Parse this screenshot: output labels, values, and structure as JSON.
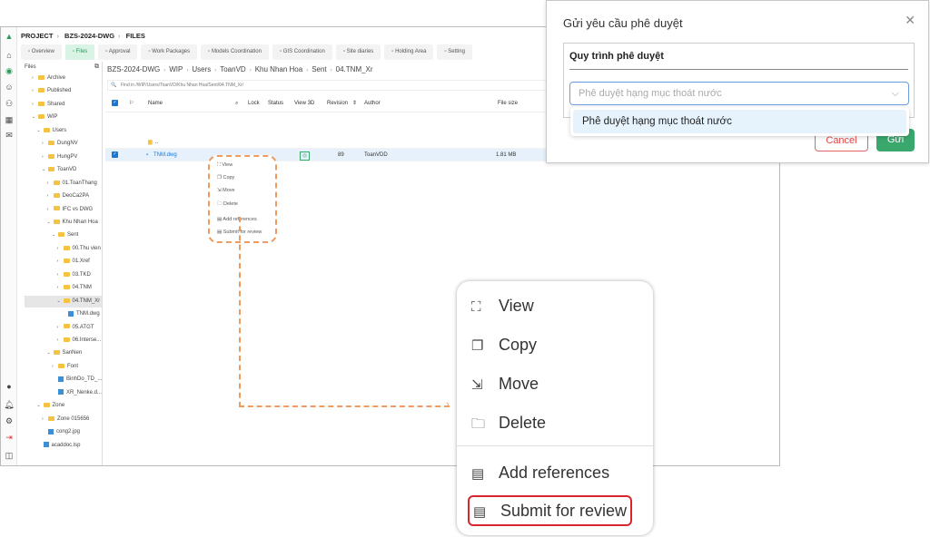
{
  "breadcrumb": [
    "PROJECT",
    "BZS-2024-DWG",
    "FILES"
  ],
  "tabs": [
    {
      "label": "Overview",
      "icon": "chart-icon"
    },
    {
      "label": "Files",
      "icon": "folder-icon",
      "active": true
    },
    {
      "label": "Approval",
      "icon": "doc-icon"
    },
    {
      "label": "Work Packages",
      "icon": "package-icon"
    },
    {
      "label": "Models Coordination",
      "icon": "model-icon"
    },
    {
      "label": "GIS Coordination",
      "icon": "globe-icon"
    },
    {
      "label": "Site diaries",
      "icon": "diary-icon"
    },
    {
      "label": "Holding Area",
      "icon": "warning-icon"
    },
    {
      "label": "Setting",
      "icon": "gear-icon"
    }
  ],
  "tree": {
    "header": "Files",
    "items": [
      {
        "label": "Archive",
        "depth": 0,
        "type": "folder",
        "caret": "›"
      },
      {
        "label": "Published",
        "depth": 0,
        "type": "folder",
        "caret": "›"
      },
      {
        "label": "Shared",
        "depth": 0,
        "type": "folder",
        "caret": "›"
      },
      {
        "label": "WIP",
        "depth": 0,
        "type": "folder",
        "caret": "⌄"
      },
      {
        "label": "Users",
        "depth": 1,
        "type": "folder",
        "caret": "⌄"
      },
      {
        "label": "DungNV",
        "depth": 2,
        "type": "folder",
        "caret": "›"
      },
      {
        "label": "HungPV",
        "depth": 2,
        "type": "folder",
        "caret": "›"
      },
      {
        "label": "ToanVD",
        "depth": 2,
        "type": "folder",
        "caret": "⌄"
      },
      {
        "label": "01.ToanThang",
        "depth": 3,
        "type": "folder",
        "caret": "›"
      },
      {
        "label": "DeoCa2PA",
        "depth": 3,
        "type": "folder",
        "caret": "›"
      },
      {
        "label": "IFC vs DWG",
        "depth": 3,
        "type": "folder",
        "caret": "›"
      },
      {
        "label": "Khu Nhan Hoa",
        "depth": 3,
        "type": "folder",
        "caret": "⌄"
      },
      {
        "label": "Sent",
        "depth": 4,
        "type": "folder",
        "caret": "⌄"
      },
      {
        "label": "00.Thu vien",
        "depth": 5,
        "type": "folder",
        "caret": "›"
      },
      {
        "label": "01.Xref",
        "depth": 5,
        "type": "folder",
        "caret": "›"
      },
      {
        "label": "03.TKD",
        "depth": 5,
        "type": "folder",
        "caret": "›"
      },
      {
        "label": "04.TNM",
        "depth": 5,
        "type": "folder",
        "caret": "›"
      },
      {
        "label": "04.TNM_Xr",
        "depth": 5,
        "type": "folder",
        "caret": "⌄",
        "selected": true
      },
      {
        "label": "TNM.dwg",
        "depth": 6,
        "type": "file",
        "caret": ""
      },
      {
        "label": "05.ATGT",
        "depth": 5,
        "type": "folder",
        "caret": "›"
      },
      {
        "label": "06.Interse...",
        "depth": 5,
        "type": "folder",
        "caret": "›"
      },
      {
        "label": "SanNen",
        "depth": 3,
        "type": "folder",
        "caret": "⌄"
      },
      {
        "label": "Font",
        "depth": 4,
        "type": "folder",
        "caret": "›"
      },
      {
        "label": "BinhDo_TD_...",
        "depth": 4,
        "type": "file",
        "caret": ""
      },
      {
        "label": "XR_Nenke.d...",
        "depth": 4,
        "type": "file",
        "caret": ""
      },
      {
        "label": "Zone",
        "depth": 1,
        "type": "folder",
        "caret": "⌄"
      },
      {
        "label": "Zone 015656",
        "depth": 2,
        "type": "folder",
        "caret": "›"
      },
      {
        "label": "cong2.jpg",
        "depth": 2,
        "type": "file",
        "caret": ""
      },
      {
        "label": "acaddoc.lsp",
        "depth": 1,
        "type": "file",
        "caret": ""
      }
    ]
  },
  "path": [
    "BZS-2024-DWG",
    "WIP",
    "Users",
    "ToanVD",
    "Khu Nhan Hoa",
    "Sent",
    "04.TNM_Xr"
  ],
  "search": {
    "placeholder": "Find in /WIP/Users/ToanVD/Khu Nhan Hoa/Sent/04.TNM_Xr/"
  },
  "table": {
    "columns": {
      "name": "Name",
      "lock": "Lock",
      "status": "Status",
      "view3d": "View 3D",
      "revision": "Revision",
      "author": "Author",
      "size": "File size"
    },
    "rows": [
      {
        "name": "..",
        "revision": "",
        "author": "",
        "size": ""
      },
      {
        "name": "TNM.dwg",
        "revision": "89",
        "author": "ToanVDD",
        "size": "1.81 MB",
        "selected": true
      }
    ]
  },
  "context_menu": {
    "items": [
      "View",
      "Copy",
      "Move",
      "Delete",
      "Add references",
      "Submit for review"
    ],
    "highlighted": "Submit for review"
  },
  "dialog": {
    "title": "Gửi yêu cầu phê duyệt",
    "section_label": "Quy trình phê duyệt",
    "select_placeholder": "Phê duyệt hạng mục thoát nước",
    "option": "Phê duyệt hạng mục thoát nước",
    "cancel": "Cancel",
    "submit": "Gửi"
  },
  "colors": {
    "accent": "#3aa76d",
    "annotation": "#ef9b60",
    "highlight": "#d9262e"
  }
}
